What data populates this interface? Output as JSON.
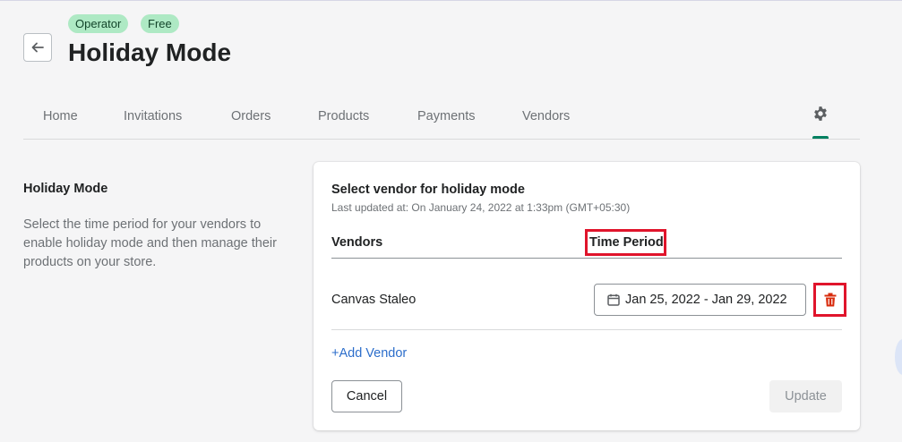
{
  "header": {
    "badges": [
      "Operator",
      "Free"
    ],
    "title": "Holiday Mode",
    "back_icon": "arrow-left-icon"
  },
  "tabs": [
    {
      "label": "Home"
    },
    {
      "label": "Invitations"
    },
    {
      "label": "Orders"
    },
    {
      "label": "Products"
    },
    {
      "label": "Payments"
    },
    {
      "label": "Vendors"
    }
  ],
  "settings_tab": {
    "icon": "gear-icon",
    "active": true
  },
  "section": {
    "title": "Holiday Mode",
    "description": "Select the time period for your vendors to enable holiday mode and then manage their products on your store."
  },
  "card": {
    "title": "Select vendor for holiday mode",
    "last_updated": "Last updated at: On January 24, 2022 at 1:33pm (GMT+05:30)",
    "columns": {
      "vendors": "Vendors",
      "time_period": "Time Period"
    },
    "rows": [
      {
        "vendor": "Canvas Staleo",
        "period": "Jan 25, 2022 - Jan 29, 2022",
        "date_icon": "calendar-icon",
        "delete_icon": "trash-icon"
      }
    ],
    "add_vendor": "+Add Vendor",
    "cancel": "Cancel",
    "update": "Update"
  },
  "colors": {
    "accent": "#008060",
    "highlight": "#e0142b",
    "badge_bg": "#aee9c4",
    "link": "#2c6ecb"
  }
}
